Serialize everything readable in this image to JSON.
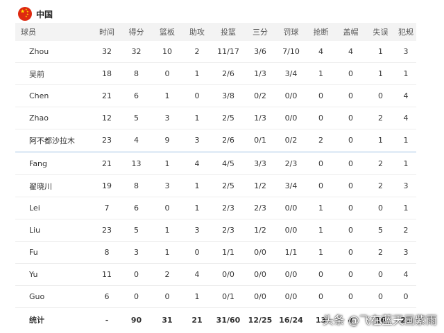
{
  "team": {
    "name": "中国"
  },
  "columns": [
    "球员",
    "时间",
    "得分",
    "篮板",
    "助攻",
    "投篮",
    "三分",
    "罚球",
    "抢断",
    "盖帽",
    "失误",
    "犯规"
  ],
  "starters": [
    [
      "Zhou",
      "32",
      "32",
      "10",
      "2",
      "11/17",
      "3/6",
      "7/10",
      "4",
      "4",
      "1",
      "3"
    ],
    [
      "吴前",
      "18",
      "8",
      "0",
      "1",
      "2/6",
      "1/3",
      "3/4",
      "1",
      "0",
      "1",
      "1"
    ],
    [
      "Chen",
      "21",
      "6",
      "1",
      "0",
      "3/8",
      "0/2",
      "0/0",
      "0",
      "0",
      "0",
      "4"
    ],
    [
      "Zhao",
      "12",
      "5",
      "3",
      "1",
      "2/5",
      "1/3",
      "0/0",
      "0",
      "0",
      "2",
      "4"
    ],
    [
      "阿不都沙拉木",
      "23",
      "4",
      "9",
      "3",
      "2/6",
      "0/1",
      "0/2",
      "2",
      "0",
      "1",
      "1"
    ]
  ],
  "bench": [
    [
      "Fang",
      "21",
      "13",
      "1",
      "4",
      "4/5",
      "3/3",
      "2/3",
      "0",
      "0",
      "2",
      "1"
    ],
    [
      "翟晓川",
      "19",
      "8",
      "3",
      "1",
      "2/5",
      "1/2",
      "3/4",
      "0",
      "0",
      "2",
      "3"
    ],
    [
      "Lei",
      "7",
      "6",
      "0",
      "1",
      "2/3",
      "2/3",
      "0/0",
      "1",
      "0",
      "0",
      "1"
    ],
    [
      "Liu",
      "23",
      "5",
      "1",
      "3",
      "2/3",
      "1/2",
      "0/0",
      "1",
      "0",
      "5",
      "2"
    ],
    [
      "Fu",
      "8",
      "3",
      "1",
      "0",
      "1/1",
      "0/0",
      "1/1",
      "1",
      "0",
      "2",
      "3"
    ],
    [
      "Yu",
      "11",
      "0",
      "2",
      "4",
      "0/0",
      "0/0",
      "0/0",
      "0",
      "0",
      "0",
      "4"
    ],
    [
      "Guo",
      "6",
      "0",
      "0",
      "1",
      "0/1",
      "0/0",
      "0/0",
      "0",
      "0",
      "0",
      "0"
    ]
  ],
  "totals": [
    "统计",
    "-",
    "90",
    "31",
    "21",
    "31/60",
    "12/25",
    "16/24",
    "13",
    "4",
    "16",
    "27"
  ],
  "watermark": "头条 @飞在蓝天画紫雨"
}
